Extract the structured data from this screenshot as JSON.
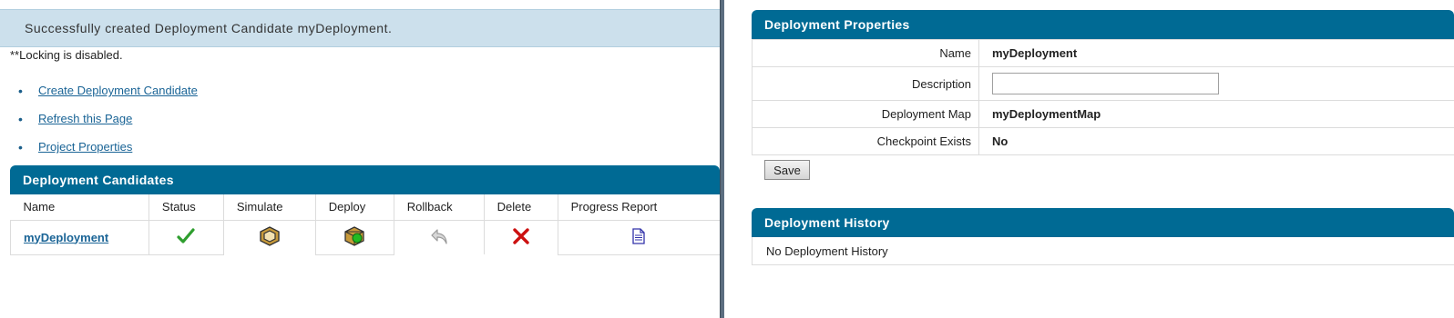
{
  "banner": {
    "message": "Successfully created Deployment Candidate myDeployment."
  },
  "lock_note": "**Locking is disabled.",
  "actions": [
    {
      "label": "Create Deployment Candidate"
    },
    {
      "label": "Refresh this Page"
    },
    {
      "label": "Project Properties"
    }
  ],
  "candidates": {
    "title": "Deployment Candidates",
    "columns": [
      "Name",
      "Status",
      "Simulate",
      "Deploy",
      "Rollback",
      "Delete",
      "Progress Report"
    ],
    "rows": [
      {
        "name": "myDeployment",
        "status_icon": "checkmark-icon",
        "simulate_icon": "simulate-icon",
        "deploy_icon": "deploy-package-icon",
        "rollback_icon": "rollback-arrow-icon",
        "delete_icon": "delete-x-icon",
        "report_icon": "document-icon"
      }
    ]
  },
  "properties": {
    "title": "Deployment Properties",
    "fields": {
      "name_label": "Name",
      "name_value": "myDeployment",
      "description_label": "Description",
      "description_value": "",
      "map_label": "Deployment Map",
      "map_value": "myDeploymentMap",
      "checkpoint_label": "Checkpoint Exists",
      "checkpoint_value": "No"
    },
    "save_label": "Save"
  },
  "history": {
    "title": "Deployment History",
    "empty_text": "No Deployment History"
  },
  "colors": {
    "header_bg": "#006a94",
    "banner_bg": "#cce0ec",
    "link": "#1a6496",
    "success_green": "#2e9e2e",
    "delete_red": "#cc1111"
  }
}
